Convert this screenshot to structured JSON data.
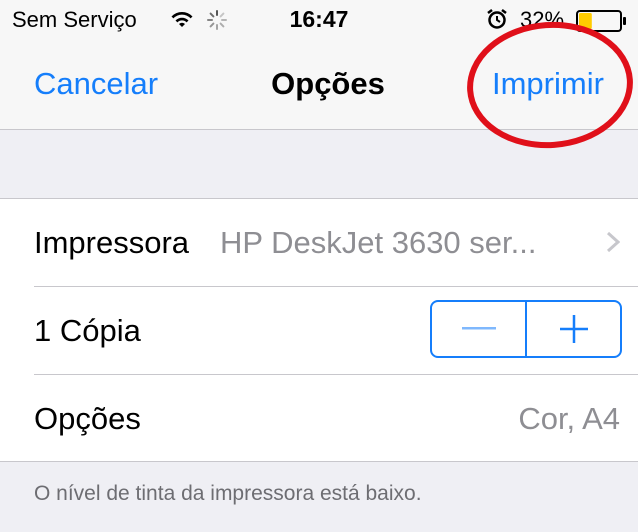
{
  "status_bar": {
    "carrier": "Sem Serviço",
    "time": "16:47",
    "battery_percent": "32%",
    "battery_level": 0.32,
    "icons": [
      "wifi-icon",
      "activity-spinner-icon",
      "alarm-icon",
      "battery-icon"
    ]
  },
  "nav": {
    "cancel_label": "Cancelar",
    "title": "Opções",
    "print_label": "Imprimir"
  },
  "settings": {
    "printer_label": "Impressora",
    "printer_value": "HP DeskJet 3630 ser...",
    "copies_label": "1 Cópia",
    "stepper_minus": "—",
    "stepper_plus": "+",
    "options_label": "Opções",
    "options_value": "Cor, A4"
  },
  "footer": {
    "note": "O nível de tinta da impressora está baixo."
  },
  "colors": {
    "accent": "#157efb",
    "annotation": "#e0101a",
    "battery_fill": "#ffcc00"
  }
}
